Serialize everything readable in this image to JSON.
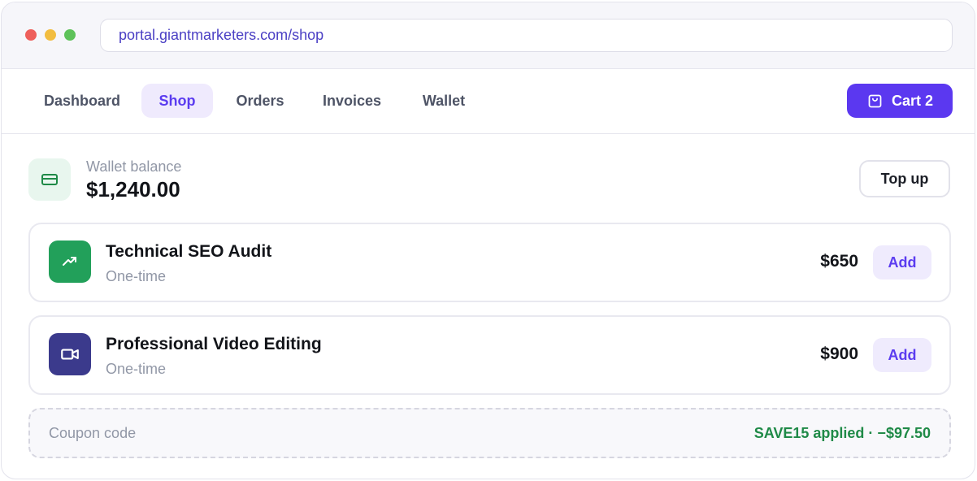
{
  "browser": {
    "url": "portal.giantmarketers.com/shop"
  },
  "nav": {
    "items": [
      {
        "label": "Dashboard",
        "active": false
      },
      {
        "label": "Shop",
        "active": true
      },
      {
        "label": "Orders",
        "active": false
      },
      {
        "label": "Invoices",
        "active": false
      },
      {
        "label": "Wallet",
        "active": false
      }
    ],
    "cart_label": "Cart 2",
    "cart_icon": "shopping-bag-icon"
  },
  "wallet": {
    "label": "Wallet balance",
    "amount": "$1,240.00",
    "icon": "credit-card-icon",
    "topup_label": "Top up"
  },
  "products": [
    {
      "name": "Technical SEO Audit",
      "billing": "One-time",
      "price": "$650",
      "add_label": "Add",
      "icon": "trending-up-icon",
      "icon_color": "#22a05a"
    },
    {
      "name": "Professional Video Editing",
      "billing": "One-time",
      "price": "$900",
      "add_label": "Add",
      "icon": "video-camera-icon",
      "icon_color": "#3b3a8c"
    }
  ],
  "coupon": {
    "label": "Coupon code",
    "status": "SAVE15 applied · −$97.50"
  },
  "colors": {
    "accent": "#5b38f0",
    "success": "#1f8a47"
  }
}
